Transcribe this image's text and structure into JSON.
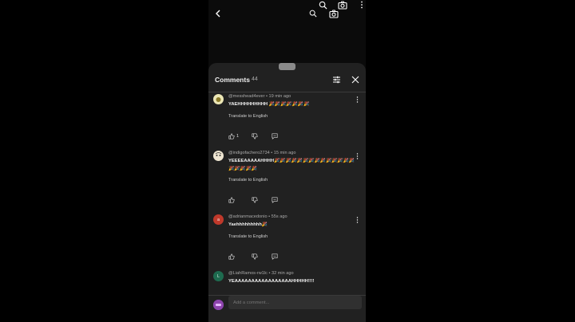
{
  "sheet": {
    "title": "Comments",
    "count": "44"
  },
  "comments": [
    {
      "author": "@messhead4ever • 19 min ago",
      "text": "YAEHHHHHHHHH 🎉🎉🎉🎉🎉🎉🎉",
      "translate": "Translate to English",
      "likes": "1",
      "avatar_color": "#e8e3b0",
      "avatar_letter": ""
    },
    {
      "author": "@indigofachero2734 • 15 min ago",
      "text": "YEEEEAAAAAHHHH🎉🎉🎉🎉🎉🎉🎉🎉🎉🎉🎉🎉🎉🎉🎉🎉🎉🎉🎉",
      "translate": "Translate to English",
      "likes": "",
      "avatar_color": "#f0e6d0",
      "avatar_letter": ""
    },
    {
      "author": "@adrianmacedonio • 55s ago",
      "text": "Yaehhhhhhhhh🎉",
      "translate": "Translate to English",
      "likes": "",
      "avatar_color": "#c0392b",
      "avatar_letter": "a"
    },
    {
      "author": "@LiahRamos-rw1lc • 32 min ago",
      "text": "YEAAAAAAAAAAAAAAAAAHHHHH!!!!",
      "translate": "",
      "likes": "",
      "avatar_color": "#1e6b4f",
      "avatar_letter": "L"
    }
  ],
  "compose": {
    "placeholder": "Add a comment..."
  },
  "colors": {
    "sheet": "#212121",
    "text": "#f1f1f1",
    "muted": "#aaaaaa"
  },
  "icons": [
    "back-arrow-icon",
    "search-icon",
    "camera-icon",
    "more-vertical-icon",
    "filter-icon",
    "close-icon",
    "thumb-up-icon",
    "thumb-down-icon",
    "reply-icon"
  ]
}
